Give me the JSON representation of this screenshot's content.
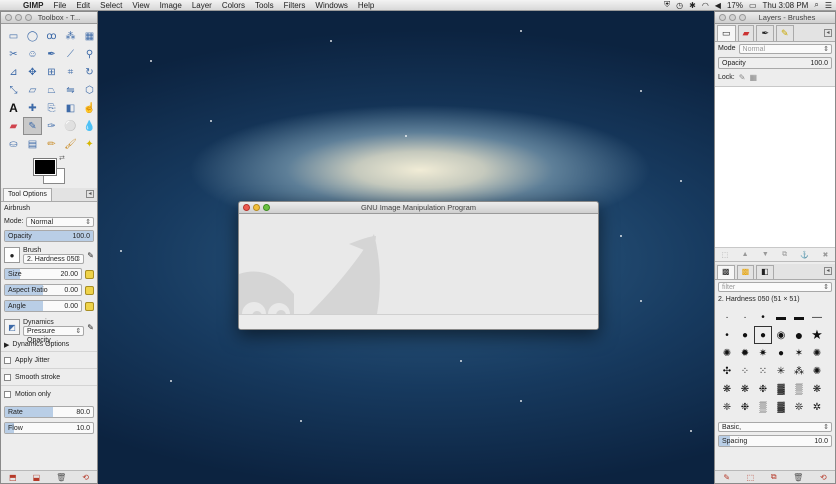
{
  "menubar": {
    "app_name": "GIMP",
    "items": [
      "File",
      "Edit",
      "Select",
      "View",
      "Image",
      "Layer",
      "Colors",
      "Tools",
      "Filters",
      "Windows",
      "Help"
    ],
    "battery": "17%",
    "clock": "Thu 3:08 PM"
  },
  "toolbox": {
    "title": "Toolbox - T...",
    "tools": [
      "rect-select",
      "ellipse-select",
      "free-select",
      "fuzzy-select",
      "select-by-color",
      "scissors",
      "foreground-select",
      "paths",
      "color-picker",
      "zoom",
      "measure",
      "move",
      "align",
      "crop",
      "rotate",
      "scale",
      "shear",
      "perspective",
      "flip",
      "cage",
      "text",
      "heal",
      "clone",
      "perspective-clone",
      "smudge",
      "eraser",
      "airbrush",
      "ink",
      "dodge",
      "blur",
      "bucket-fill",
      "blend",
      "pencil",
      "paintbrush",
      "convolve"
    ],
    "selected_tool_index": 21
  },
  "tool_options": {
    "tab": "Tool Options",
    "tool_name": "Airbrush",
    "mode_label": "Mode:",
    "mode_value": "Normal",
    "opacity_label": "Opacity",
    "opacity_value": "100.0",
    "opacity_fill": 1.0,
    "brush_label": "Brush",
    "brush_value": "2. Hardness 050",
    "size_label": "Size",
    "size_value": "20.00",
    "size_fill": 0.2,
    "aspect_label": "Aspect Ratio",
    "aspect_value": "0.00",
    "aspect_fill": 0.5,
    "angle_label": "Angle",
    "angle_value": "0.00",
    "angle_fill": 0.5,
    "dynamics_label": "Dynamics",
    "dynamics_value": "Pressure Opacity",
    "dynamics_options": "Dynamics Options",
    "apply_jitter": "Apply Jitter",
    "smooth_stroke": "Smooth stroke",
    "motion_only": "Motion only",
    "rate_label": "Rate",
    "rate_value": "80.0",
    "rate_fill": 0.55,
    "flow_label": "Flow",
    "flow_value": "10.0",
    "flow_fill": 0.1
  },
  "splash": {
    "title": "GNU Image Manipulation Program"
  },
  "layers": {
    "title": "Layers - Brushes",
    "mode_label": "Mode",
    "mode_value": "Normal",
    "opacity_label": "Opacity",
    "opacity_value": "100.0",
    "lock_label": "Lock:"
  },
  "brushes": {
    "filter_placeholder": "filter",
    "selected_brush": "2. Hardness 050 (51 × 51)",
    "tag_value": "Basic,",
    "spacing_label": "Spacing",
    "spacing_value": "10.0",
    "spacing_fill": 0.1
  }
}
